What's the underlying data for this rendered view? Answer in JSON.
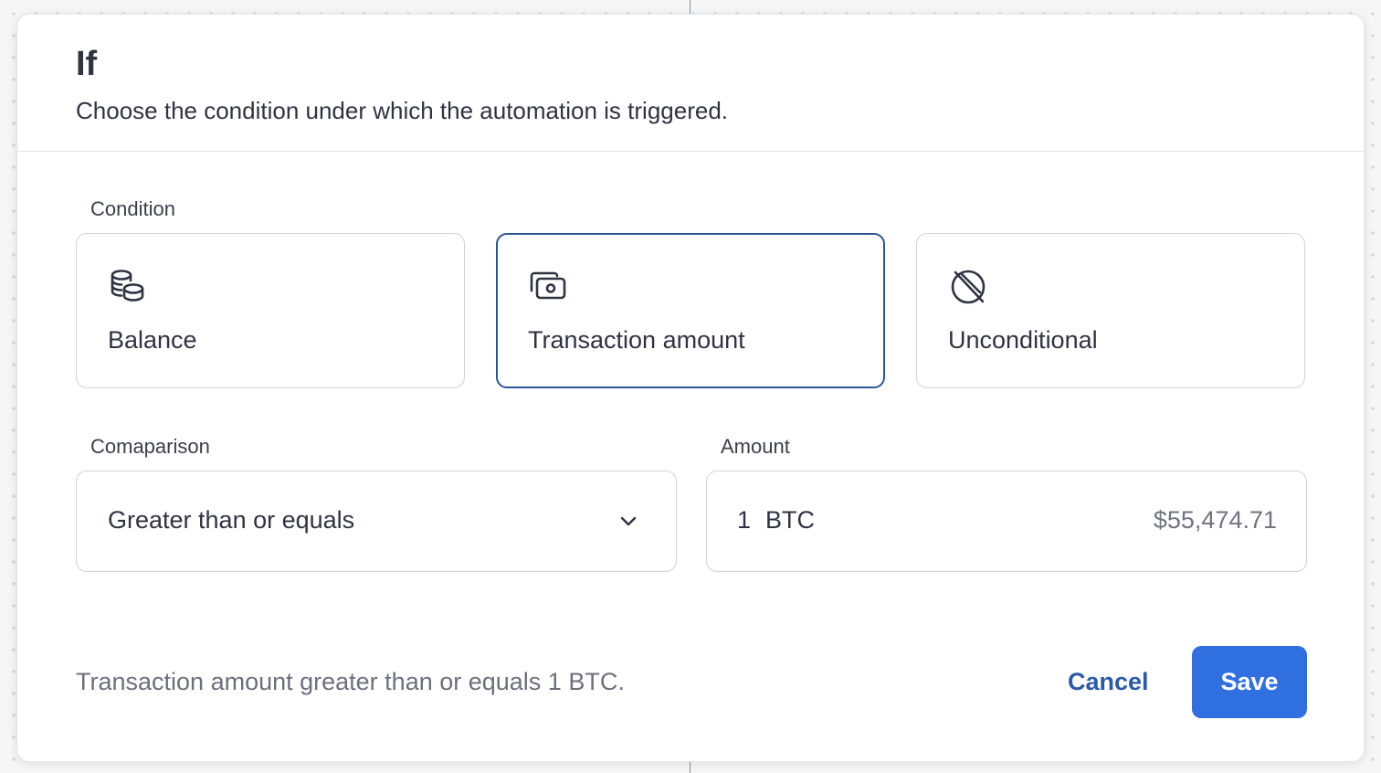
{
  "dialog": {
    "title": "If",
    "subtitle": "Choose the condition under which the automation is triggered."
  },
  "condition": {
    "label": "Condition",
    "selected": "Transaction amount",
    "options": [
      {
        "label": "Balance",
        "icon": "coins-stack-icon"
      },
      {
        "label": "Transaction amount",
        "icon": "cash-icon"
      },
      {
        "label": "Unconditional",
        "icon": "slashed-circle-icon"
      }
    ]
  },
  "comparison": {
    "label": "Comaparison",
    "value": "Greater than or equals",
    "icon": "chevron-down-icon"
  },
  "amount": {
    "label": "Amount",
    "quantity": "1",
    "unit": "BTC",
    "fiat_value": "$55,474.71"
  },
  "footer": {
    "summary": "Transaction amount greater than or equals 1 BTC.",
    "cancel_label": "Cancel",
    "save_label": "Save"
  },
  "colors": {
    "accent": "#2f6fe0",
    "selected_border": "#2e5597",
    "link": "#2a5aa8"
  }
}
